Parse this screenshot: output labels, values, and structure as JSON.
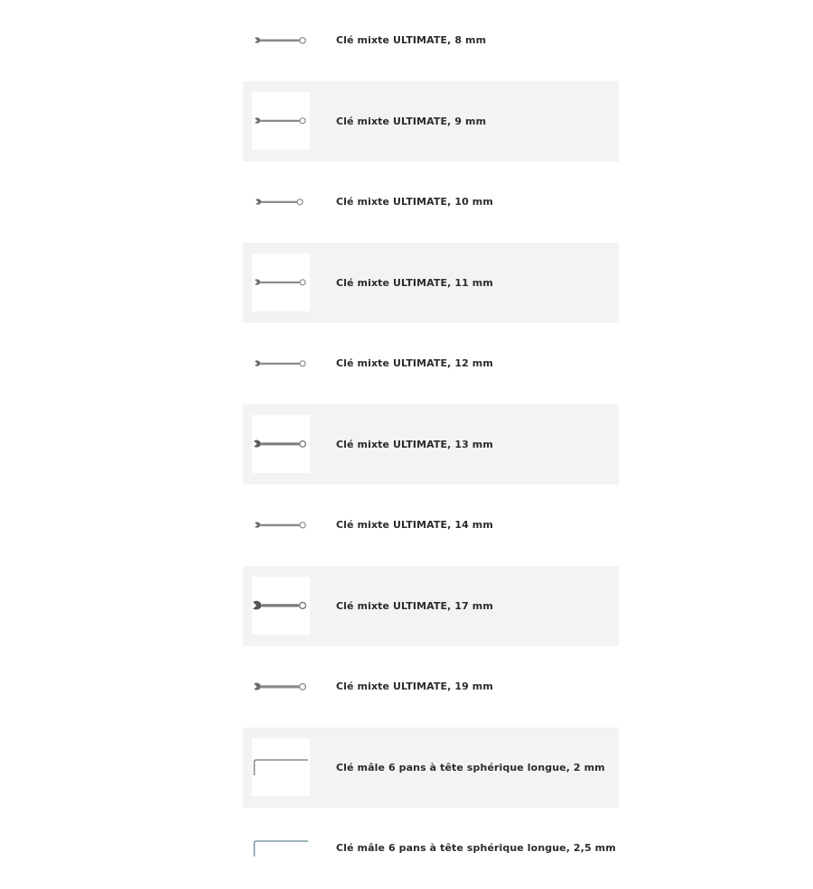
{
  "products": [
    {
      "name": "Clé mixte ULTIMATE, 8 mm",
      "icon": "combination-wrench-icon"
    },
    {
      "name": "Clé mixte ULTIMATE, 9 mm",
      "icon": "combination-wrench-icon"
    },
    {
      "name": "Clé mixte ULTIMATE, 10 mm",
      "icon": "combination-wrench-icon"
    },
    {
      "name": "Clé mixte ULTIMATE, 11 mm",
      "icon": "combination-wrench-icon"
    },
    {
      "name": "Clé mixte ULTIMATE, 12 mm",
      "icon": "combination-wrench-icon"
    },
    {
      "name": "Clé mixte ULTIMATE, 13 mm",
      "icon": "combination-wrench-icon"
    },
    {
      "name": "Clé mixte ULTIMATE, 14 mm",
      "icon": "combination-wrench-icon"
    },
    {
      "name": "Clé mixte ULTIMATE, 17 mm",
      "icon": "combination-wrench-icon"
    },
    {
      "name": "Clé mixte ULTIMATE, 19 mm",
      "icon": "combination-wrench-icon"
    },
    {
      "name": "Clé mâle 6 pans à tête sphérique longue, 2 mm",
      "icon": "hex-key-icon"
    },
    {
      "name": "Clé mâle 6 pans à tête sphérique longue, 2,5 mm",
      "icon": "hex-key-icon"
    }
  ],
  "colors": {
    "row_alt_bg": "#f3f3f3",
    "text": "#2b2b2b",
    "tool_metal": "#8a8a8a"
  }
}
